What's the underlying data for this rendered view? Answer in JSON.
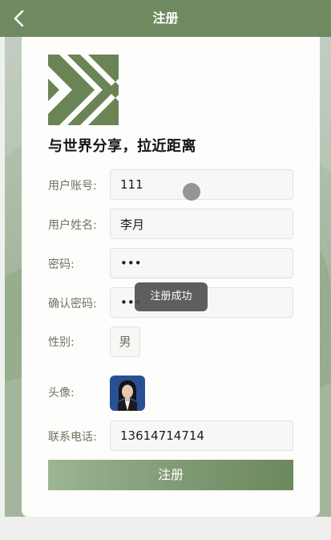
{
  "header": {
    "title": "注册",
    "back_icon": "chevron-left-icon"
  },
  "tagline": "与世界分享，拉近距离",
  "form": {
    "account": {
      "label": "用户账号:",
      "value": "111"
    },
    "name": {
      "label": "用户姓名:",
      "value": "李月"
    },
    "password": {
      "label": "密码:",
      "value": "•••"
    },
    "confirm": {
      "label": "确认密码:",
      "value": "•••"
    },
    "gender": {
      "label": "性别:",
      "value": "男"
    },
    "avatar": {
      "label": "头像:",
      "icon": "avatar-photo"
    },
    "phone": {
      "label": "联系电话:",
      "value": "13614714714"
    },
    "submit_label": "注册"
  },
  "toast": "注册成功",
  "colors": {
    "header": "#6f8a60",
    "accent": "#7f9a73"
  }
}
